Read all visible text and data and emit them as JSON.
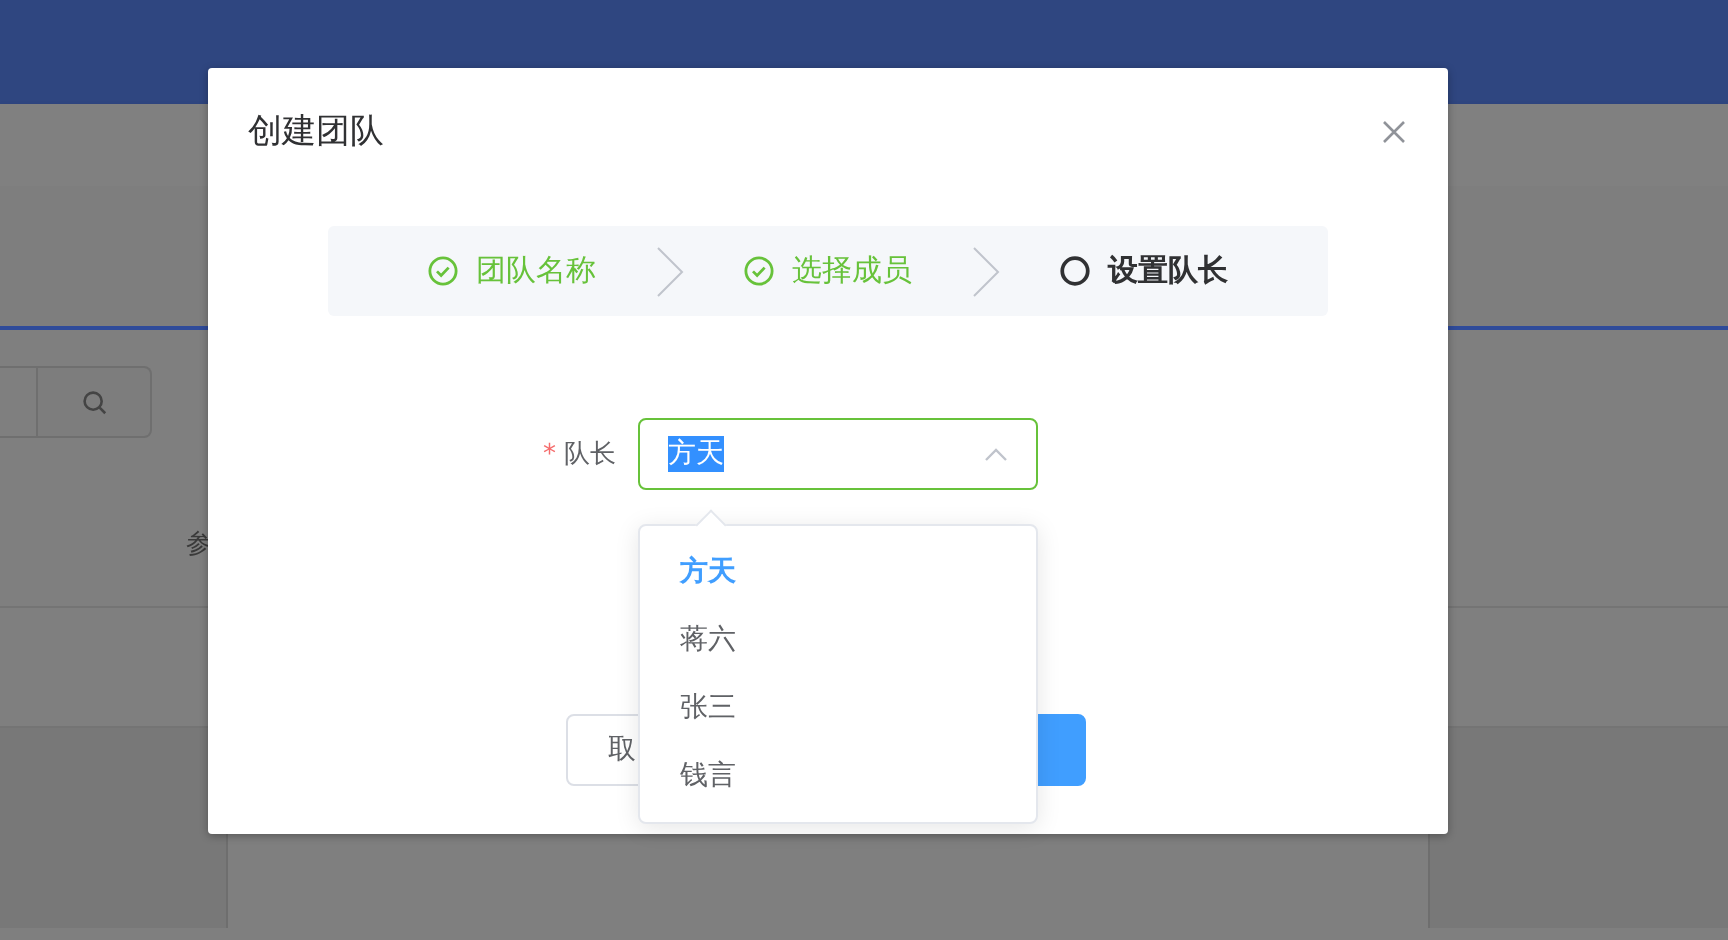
{
  "background": {
    "column_header": "参"
  },
  "dialog": {
    "title": "创建团队",
    "steps": [
      {
        "label": "团队名称",
        "done": true,
        "active": false
      },
      {
        "label": "选择成员",
        "done": true,
        "active": false
      },
      {
        "label": "设置队长",
        "done": false,
        "active": true
      }
    ],
    "field": {
      "label": "队长",
      "required_mark": "*",
      "value": "方天",
      "expanded": true
    },
    "options": [
      {
        "label": "方天",
        "selected": true
      },
      {
        "label": "蒋六",
        "selected": false
      },
      {
        "label": "张三",
        "selected": false
      },
      {
        "label": "钱言",
        "selected": false
      }
    ],
    "buttons": [
      {
        "kind": "default",
        "label": "取"
      },
      {
        "kind": "primary"
      }
    ]
  }
}
